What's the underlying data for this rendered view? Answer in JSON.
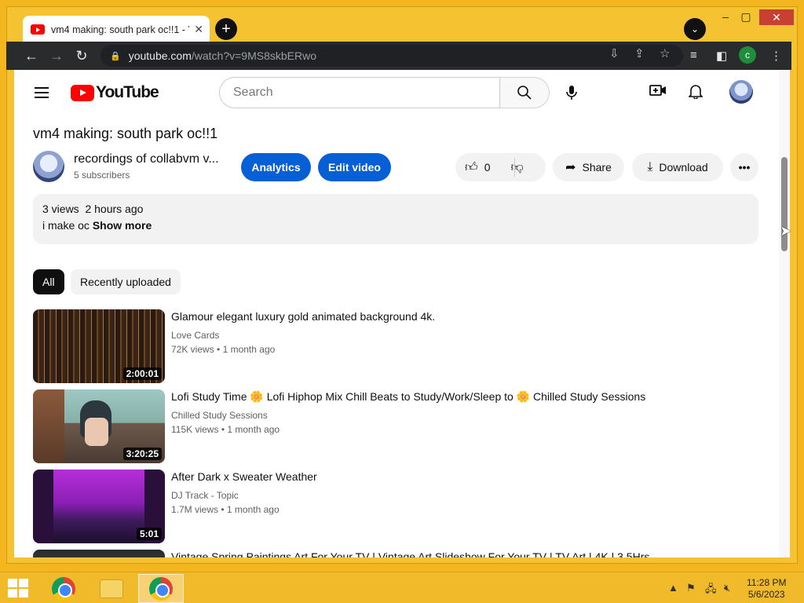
{
  "browser": {
    "tab_title": "vm4 making: south park oc!!1 - Y",
    "new_tab": "+",
    "url_host": "youtube.com",
    "url_path": "/watch?v=9MS8skbERwo",
    "profile_initial": "c"
  },
  "youtube": {
    "logo_text": "YouTube",
    "search_placeholder": "Search",
    "video_title": "vm4 making: south park oc!!1",
    "channel_name": "recordings of collabvm v...",
    "subscribers": "5 subscribers",
    "analytics_label": "Analytics",
    "edit_label": "Edit video",
    "like_count": "0",
    "share_label": "Share",
    "download_label": "Download",
    "views": "3 views",
    "age": "2 hours ago",
    "description": "i make oc",
    "show_more": "Show more",
    "chips": [
      "All",
      "Recently uploaded"
    ]
  },
  "recommendations": [
    {
      "title": "Glamour elegant luxury gold animated background 4k.",
      "channel": "Love Cards",
      "views": "72K views",
      "age": "1 month ago",
      "duration": "2:00:01"
    },
    {
      "title": "Lofi Study Time 🌼 Lofi Hiphop Mix Chill Beats to Study/Work/Sleep to 🌼 Chilled Study Sessions",
      "channel": "Chilled Study Sessions",
      "views": "115K views",
      "age": "1 month ago",
      "duration": "3:20:25"
    },
    {
      "title": "After Dark x Sweater Weather",
      "channel": "DJ Track - Topic",
      "views": "1.7M views",
      "age": "1 month ago",
      "duration": "5:01"
    },
    {
      "title": "Vintage Spring Paintings Art For Your TV | Vintage Art Slideshow For Your TV | TV Art | 4K | 3.5Hrs",
      "channel": "",
      "views": "",
      "age": "",
      "duration": ""
    }
  ],
  "taskbar": {
    "time": "11:28 PM",
    "date": "5/6/2023"
  },
  "colors": {
    "accent_blue": "#065fd4",
    "youtube_red": "#ff0000",
    "desktop_gold": "#f3b61e"
  }
}
